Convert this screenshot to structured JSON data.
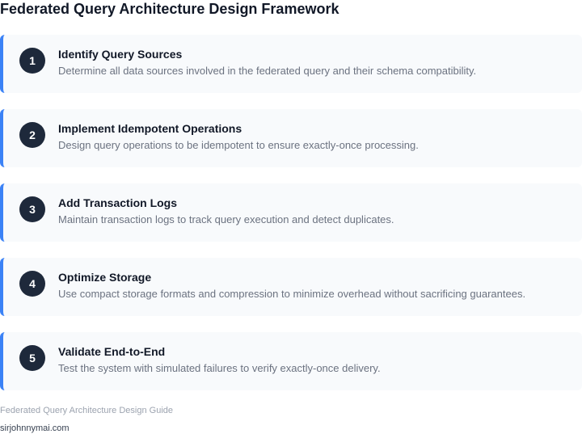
{
  "header": {
    "title": "Federated Query Architecture Design Framework"
  },
  "steps": [
    {
      "number": "1",
      "title": "Identify Query Sources",
      "description": "Determine all data sources involved in the federated query and their schema compatibility."
    },
    {
      "number": "2",
      "title": "Implement Idempotent Operations",
      "description": "Design query operations to be idempotent to ensure exactly-once processing."
    },
    {
      "number": "3",
      "title": "Add Transaction Logs",
      "description": "Maintain transaction logs to track query execution and detect duplicates."
    },
    {
      "number": "4",
      "title": "Optimize Storage",
      "description": "Use compact storage formats and compression to minimize overhead without sacrificing guarantees."
    },
    {
      "number": "5",
      "title": "Validate End-to-End",
      "description": "Test the system with simulated failures to verify exactly-once delivery."
    }
  ],
  "footer": {
    "guide": "Federated Query Architecture Design Guide",
    "site": "sirjohnnymai.com"
  },
  "colors": {
    "accent": "#3b82f6",
    "badge": "#1e293b",
    "card_background": "#f8fafc"
  }
}
